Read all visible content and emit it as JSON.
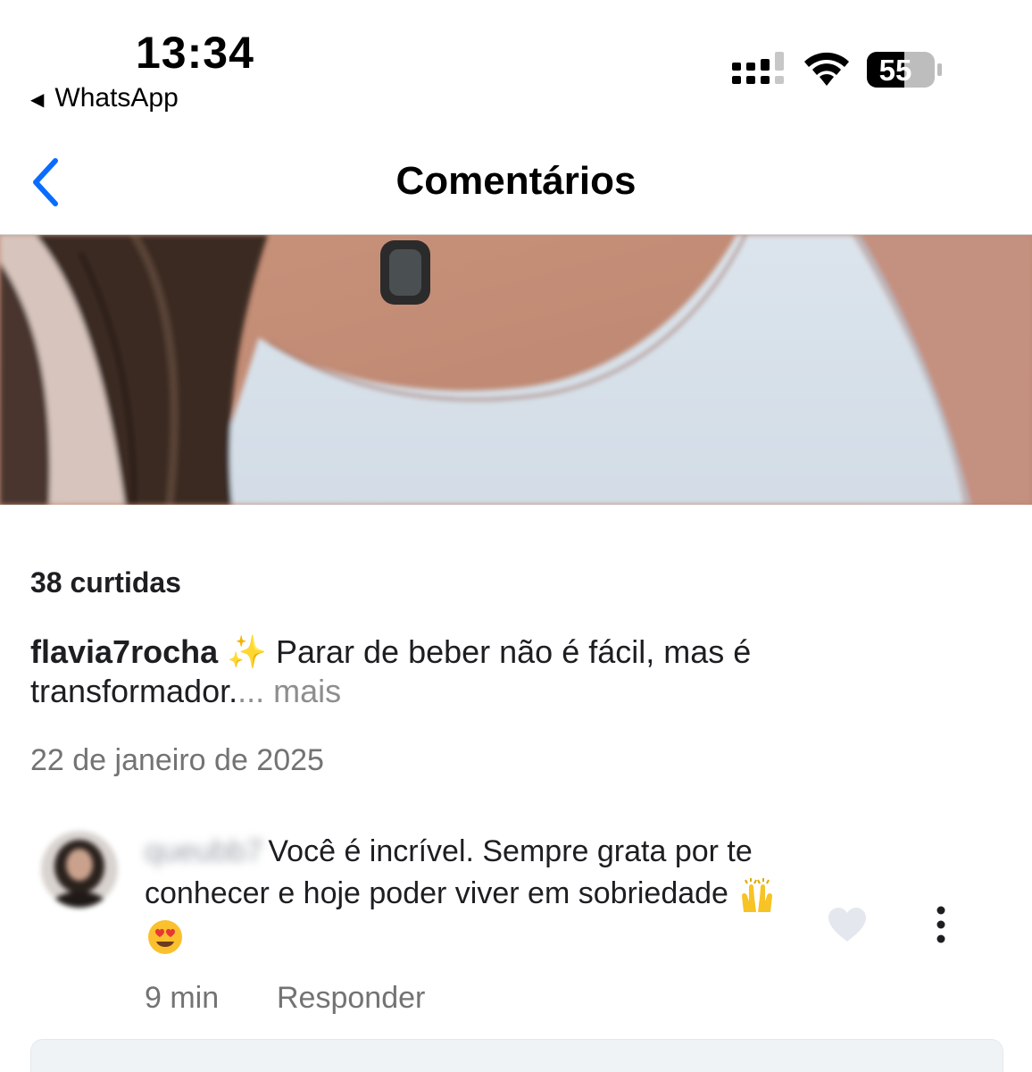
{
  "status_bar": {
    "time": "13:34",
    "back_app": "WhatsApp",
    "battery": "55"
  },
  "nav": {
    "title": "Comentários"
  },
  "post": {
    "likes": "38 curtidas",
    "caption_user": "flavia7rocha",
    "caption_emoji": "✨",
    "caption_text": "Parar de beber não é fácil, mas é transformador.",
    "caption_ellipsis": "... ",
    "caption_more": "mais",
    "date": "22 de janeiro de 2025"
  },
  "comment": {
    "username": "queubb7",
    "text": "Você é incrível. Sempre grata por te conhecer e hoje poder viver em sobriedade",
    "emojis": [
      "raising-hands-icon",
      "heart-eyes-face-icon"
    ],
    "time": "9 min",
    "reply_label": "Responder"
  },
  "colors": {
    "accent_blue": "#0a6cff",
    "text_primary": "#1c1e21",
    "text_secondary": "#737373"
  }
}
